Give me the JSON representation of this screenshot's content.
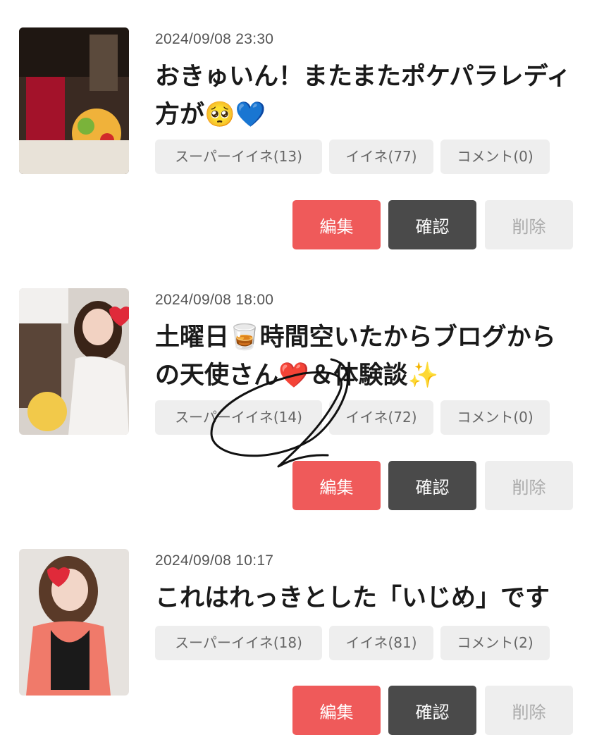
{
  "posts": [
    {
      "date": "2024/09/08 23:30",
      "title": "おきゅいん！またまたポケパラレディ方が🥺💙",
      "stats": {
        "super": "スーパーイイネ(13)",
        "like": "イイネ(77)",
        "comment": "コメント(0)"
      },
      "buttons": {
        "edit": "編集",
        "check": "確認",
        "delete": "削除"
      }
    },
    {
      "date": "2024/09/08 18:00",
      "title": "土曜日🥃時間空いたからブログからの天使さん❤️＆体験談✨",
      "stats": {
        "super": "スーパーイイネ(14)",
        "like": "イイネ(72)",
        "comment": "コメント(0)"
      },
      "buttons": {
        "edit": "編集",
        "check": "確認",
        "delete": "削除"
      }
    },
    {
      "date": "2024/09/08 10:17",
      "title": "これはれっきとした「いじめ」です",
      "stats": {
        "super": "スーパーイイネ(18)",
        "like": "イイネ(81)",
        "comment": "コメント(2)"
      },
      "buttons": {
        "edit": "編集",
        "check": "確認",
        "delete": "削除"
      }
    }
  ],
  "colors": {
    "edit": "#ef5a5a",
    "check": "#4a4a4a",
    "delete_bg": "#eeeeee",
    "stat_bg": "#eeeeee"
  }
}
